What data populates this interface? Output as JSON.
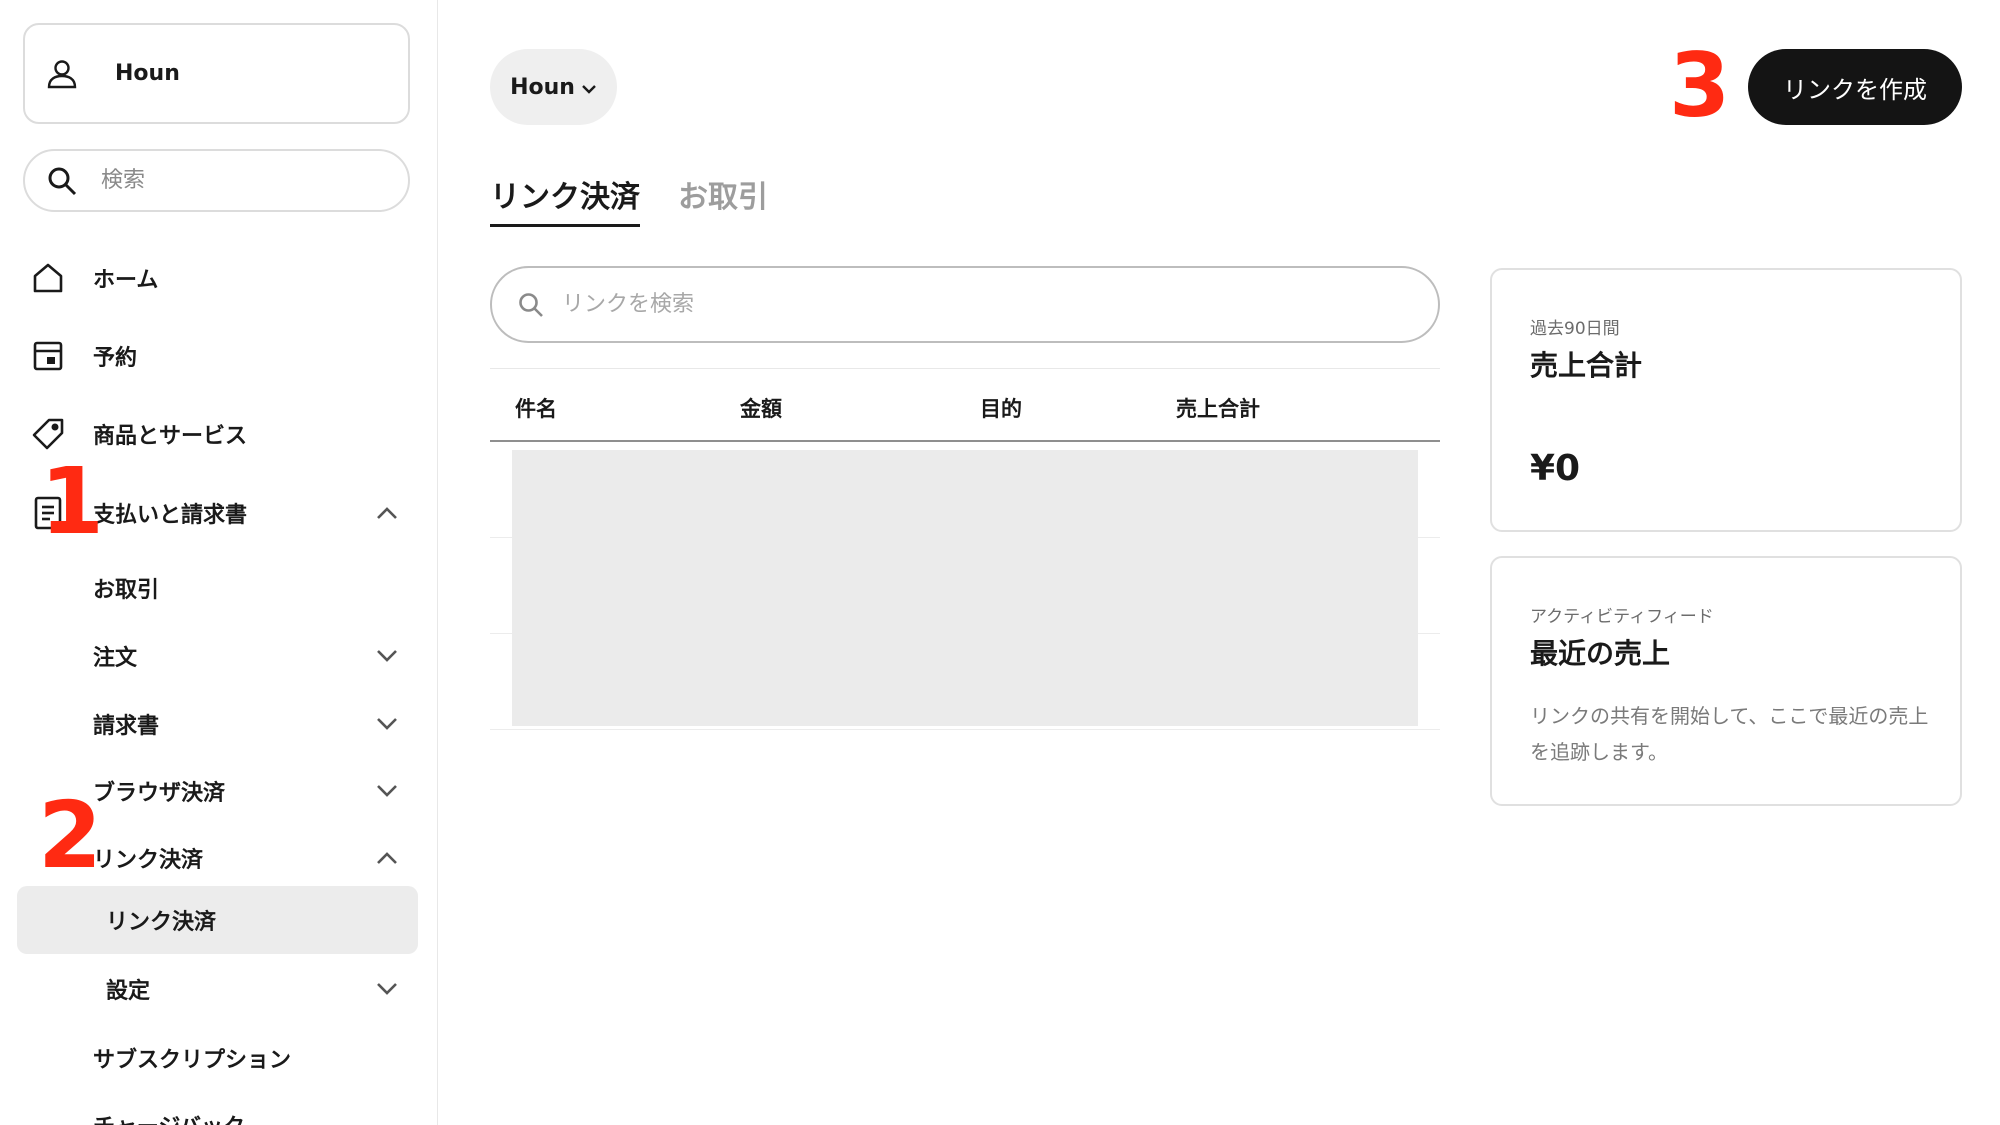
{
  "sidebar": {
    "account_name": "Houn",
    "search_placeholder": "検索",
    "items": [
      {
        "label": "ホーム"
      },
      {
        "label": "予約"
      },
      {
        "label": "商品とサービス"
      },
      {
        "label": "支払いと請求書"
      },
      {
        "label": "お取引"
      },
      {
        "label": "注文"
      },
      {
        "label": "請求書"
      },
      {
        "label": "ブラウザ決済"
      },
      {
        "label": "リンク決済"
      },
      {
        "label": "リンク決済"
      },
      {
        "label": "設定"
      },
      {
        "label": "サブスクリプション"
      },
      {
        "label": "チャージバック"
      }
    ],
    "markers": [
      "1",
      "2"
    ]
  },
  "header": {
    "account_label": "Houn",
    "create_button": "リンクを作成",
    "marker": "3"
  },
  "tabs": [
    {
      "label": "リンク決済",
      "active": true
    },
    {
      "label": "お取引",
      "active": false
    }
  ],
  "search": {
    "placeholder": "リンクを検索"
  },
  "table": {
    "columns": [
      "件名",
      "金額",
      "目的",
      "売上合計"
    ]
  },
  "cards": {
    "sales": {
      "kicker": "過去90日間",
      "title": "売上合計",
      "amount": "¥0"
    },
    "feed": {
      "kicker": "アクティビティフィード",
      "title": "最近の売上",
      "description": "リンクの共有を開始して、ここで最近の売上を追跡します。"
    }
  },
  "colors": {
    "accent_marker": "#ff2a12",
    "button_dark": "#141414"
  }
}
